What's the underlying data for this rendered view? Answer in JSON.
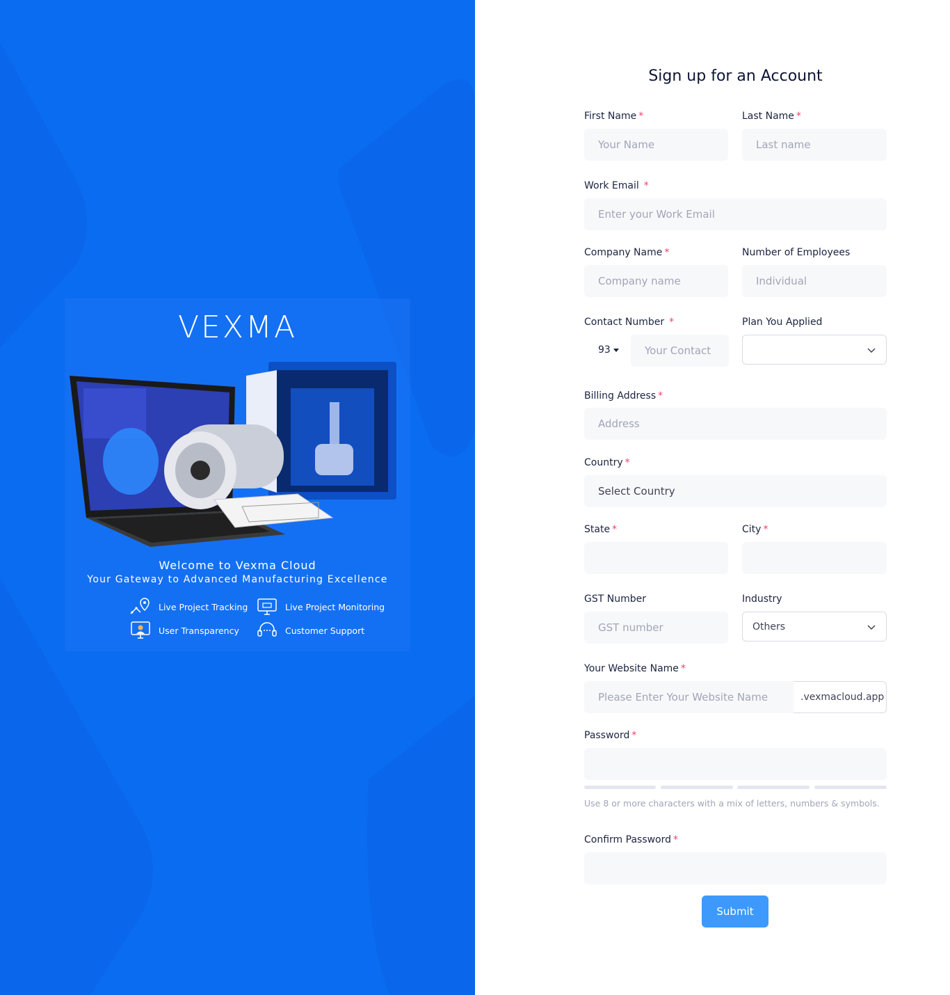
{
  "brand": {
    "name": "VEXMA"
  },
  "hero": {
    "welcome": "Welcome to Vexma Cloud",
    "tagline": "Your Gateway to Advanced Manufacturing Excellence",
    "features": [
      {
        "label": "Live Project Tracking",
        "icon": "map-pin-icon"
      },
      {
        "label": "Live Project Monitoring",
        "icon": "monitor-icon"
      },
      {
        "label": "User Transparency",
        "icon": "user-screen-icon"
      },
      {
        "label": "Customer Support",
        "icon": "headset-icon"
      }
    ]
  },
  "form": {
    "title": "Sign up for an Account",
    "first_name": {
      "label": "First Name",
      "placeholder": "Your Name"
    },
    "last_name": {
      "label": "Last Name",
      "placeholder": "Last name"
    },
    "work_email": {
      "label": "Work Email",
      "placeholder": "Enter your Work Email"
    },
    "company_name": {
      "label": "Company Name",
      "placeholder": "Company name"
    },
    "employees": {
      "label": "Number of Employees",
      "placeholder": "Individual"
    },
    "contact": {
      "label": "Contact Number",
      "code": "93",
      "placeholder": "Your Contact"
    },
    "plan": {
      "label": "Plan You Applied",
      "value": ""
    },
    "billing": {
      "label": "Billing Address",
      "placeholder": "Address"
    },
    "country": {
      "label": "Country",
      "value": "Select Country"
    },
    "state": {
      "label": "State",
      "value": ""
    },
    "city": {
      "label": "City",
      "value": ""
    },
    "gst": {
      "label": "GST Number",
      "placeholder": "GST number"
    },
    "industry": {
      "label": "Industry",
      "value": "Others"
    },
    "website": {
      "label": "Your Website Name",
      "placeholder": "Please Enter Your Website Name",
      "suffix": ".vexmacloud.app"
    },
    "password": {
      "label": "Password",
      "hint": "Use 8 or more characters with a mix of letters, numbers & symbols."
    },
    "confirm_password": {
      "label": "Confirm Password"
    },
    "submit_label": "Submit",
    "required_mark": "*"
  },
  "colors": {
    "hero_bg": "#0a6cf0",
    "accent": "#3d99fc",
    "required": "#f1416c"
  }
}
